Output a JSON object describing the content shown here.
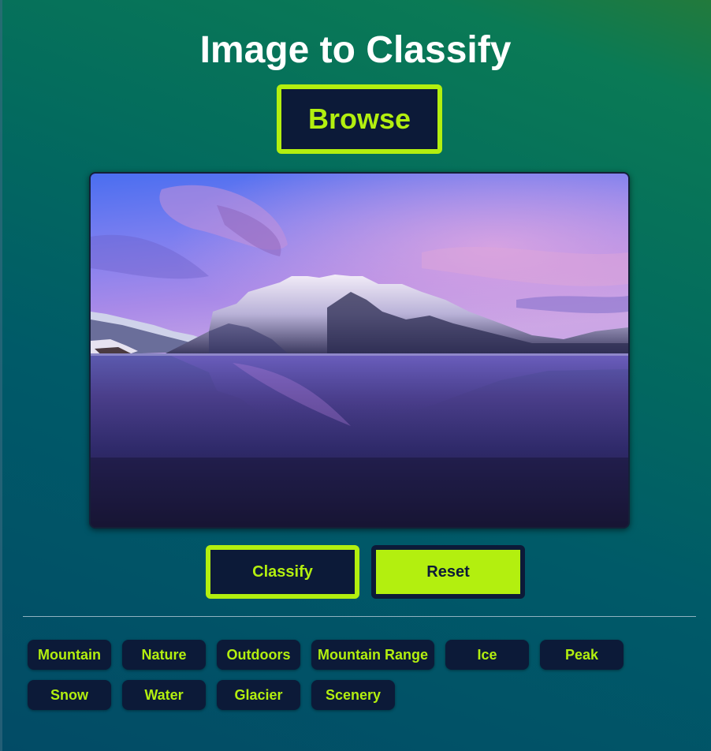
{
  "title": "Image to Classify",
  "browse_label": "Browse",
  "classify_label": "Classify",
  "reset_label": "Reset",
  "tags": [
    "Mountain",
    "Nature",
    "Outdoors",
    "Mountain Range",
    "Ice",
    "Peak",
    "Snow",
    "Water",
    "Glacier",
    "Scenery"
  ],
  "colors": {
    "accent": "#b3ef0f",
    "dark": "#0c1a38",
    "title": "#ffffff"
  },
  "preview_image": {
    "subject": "snow-capped mountain reflected in a lake at dusk"
  }
}
